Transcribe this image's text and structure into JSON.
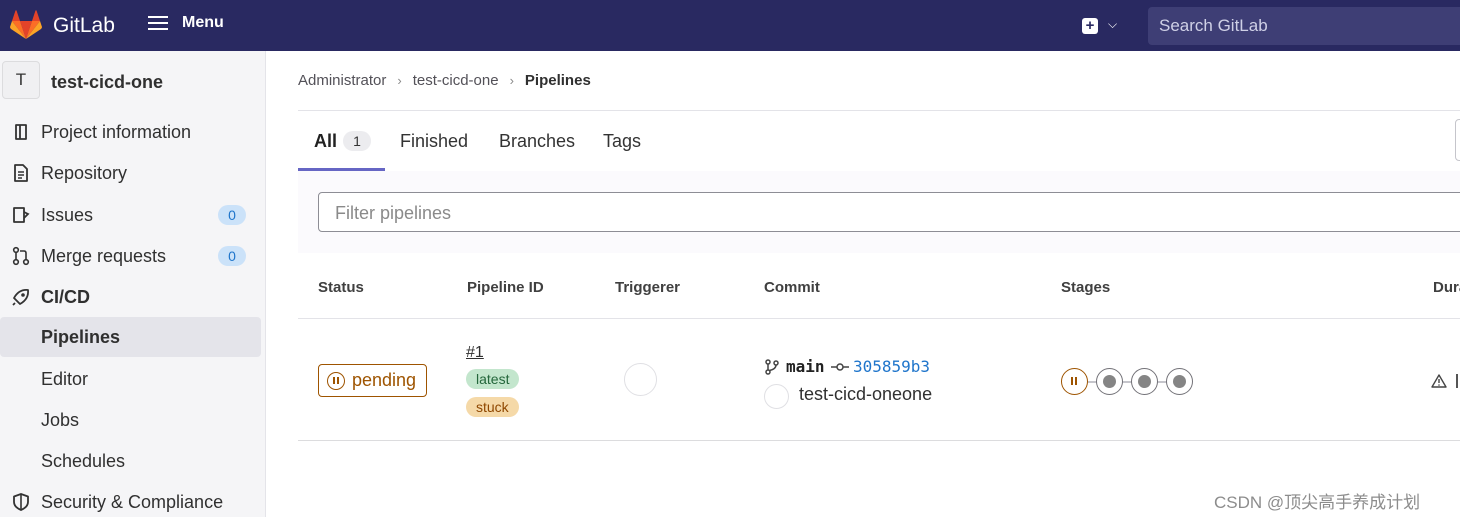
{
  "header": {
    "brand": "GitLab",
    "menu_label": "Menu",
    "search_placeholder": "Search GitLab"
  },
  "sidebar": {
    "project_initial": "T",
    "project_name": "test-cicd-one",
    "items": [
      {
        "label": "Project information",
        "icon": "project-information-icon"
      },
      {
        "label": "Repository",
        "icon": "document-icon"
      },
      {
        "label": "Issues",
        "icon": "issues-icon",
        "badge": "0"
      },
      {
        "label": "Merge requests",
        "icon": "merge-request-icon",
        "badge": "0"
      },
      {
        "label": "CI/CD",
        "icon": "rocket-icon"
      },
      {
        "label": "Pipelines"
      },
      {
        "label": "Editor"
      },
      {
        "label": "Jobs"
      },
      {
        "label": "Schedules"
      },
      {
        "label": "Security & Compliance",
        "icon": "shield-icon"
      }
    ]
  },
  "breadcrumb": [
    "Administrator",
    "test-cicd-one",
    "Pipelines"
  ],
  "tabs": {
    "all": "All",
    "all_count": "1",
    "finished": "Finished",
    "branches": "Branches",
    "tags": "Tags"
  },
  "filter": {
    "placeholder": "Filter pipelines"
  },
  "table": {
    "headers": [
      "Status",
      "Pipeline ID",
      "Triggerer",
      "Commit",
      "Stages",
      "Dura"
    ],
    "rows": [
      {
        "status": "pending",
        "pipeline_id": "#1",
        "tags": [
          "latest",
          "stuck"
        ],
        "branch": "main",
        "sha": "305859b3",
        "message": "test-cicd-oneone",
        "stages": [
          "pending",
          "created",
          "created",
          "created"
        ]
      }
    ]
  },
  "watermark": "CSDN @顶尖高手养成计划",
  "colors": {
    "topbar": "#292961",
    "tab_underline": "#6666c4",
    "pending": "#9e5400",
    "link": "#1f75cb"
  }
}
